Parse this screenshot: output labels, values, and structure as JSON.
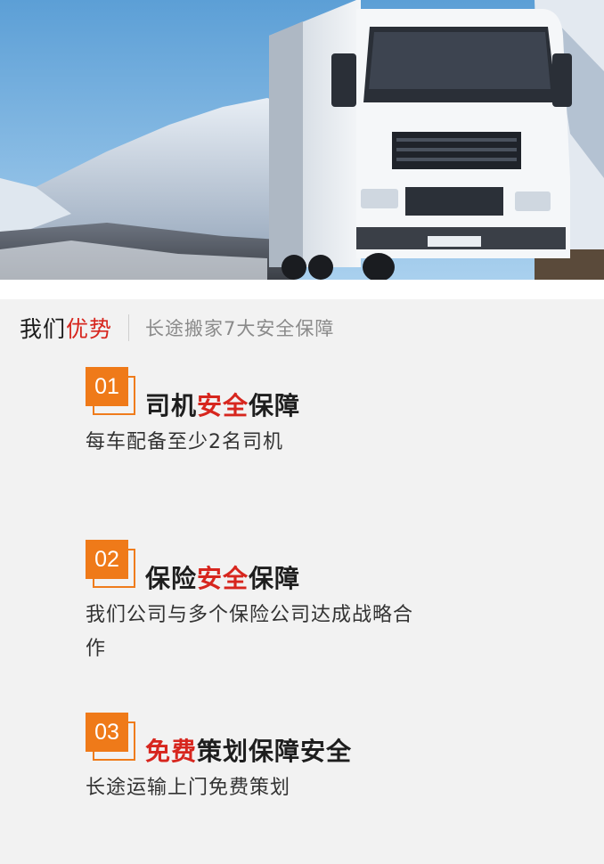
{
  "hero": {
    "image": "white-truck-snowy-mountains"
  },
  "section": {
    "title_black": "我们",
    "title_red": "优势",
    "subtitle": "长途搬家7大安全保障"
  },
  "items": [
    {
      "number": "01",
      "title_pre": "司机",
      "title_red": "安全",
      "title_post": "保障",
      "desc": "每车配备至少2名司机"
    },
    {
      "number": "02",
      "title_pre": "保险",
      "title_red": "安全",
      "title_post": "保障",
      "desc": "我们公司与多个保险公司达成战略合作"
    },
    {
      "number": "03",
      "title_pre": "",
      "title_red": "免费",
      "title_post": "策划保障安全",
      "desc": "长途运输上门免费策划"
    }
  ],
  "colors": {
    "accent_red": "#d7261e",
    "badge_orange": "#ef7a19"
  }
}
